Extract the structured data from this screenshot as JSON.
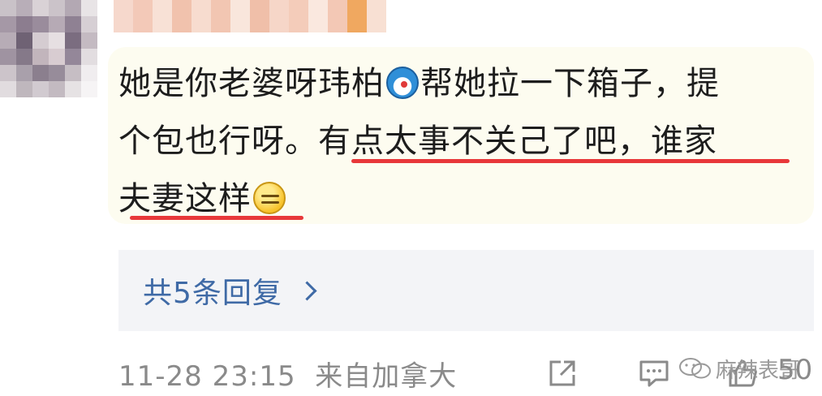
{
  "comment": {
    "line1_a": "她是你老婆呀玮柏",
    "emoji1": "doraemon-emoji",
    "line1_b": "帮她拉一下箱子，提",
    "line2_a": "个包也行呀。",
    "line2_b": "有点太事不关己了吧，谁家",
    "line3": "夫妻这样",
    "emoji2": "smirk-emoji"
  },
  "replies": {
    "label": "共5条回复"
  },
  "footer": {
    "timestamp": "11-28 23:15",
    "source": "来自加拿大",
    "like_count": "50",
    "watermark": "麻辣表哥"
  },
  "colors": {
    "bubble_bg": "#fdfcf0",
    "underline": "#e8383a",
    "link": "#3f6aa6",
    "meta_text": "#8a8a8a"
  }
}
